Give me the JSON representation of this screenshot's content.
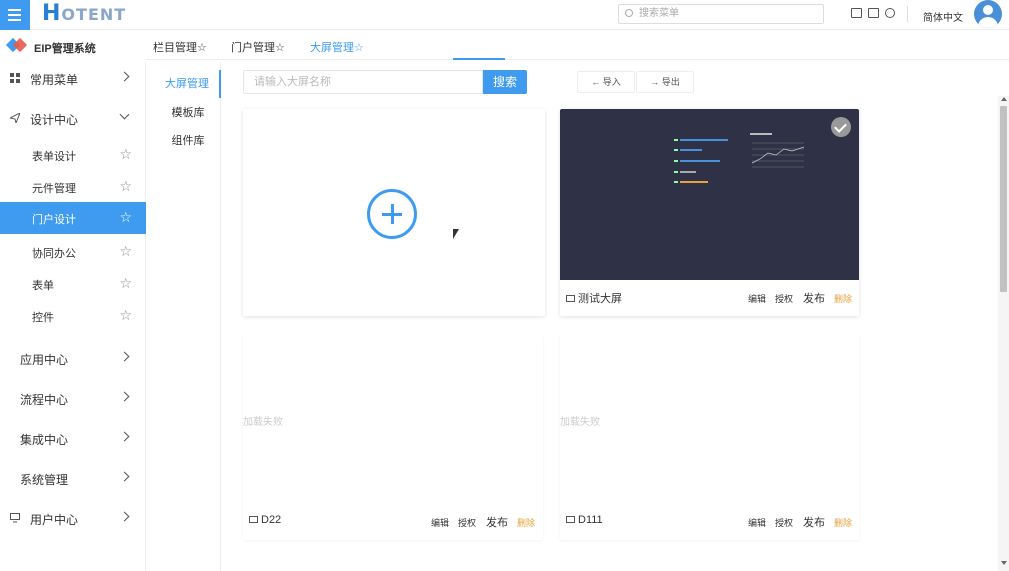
{
  "header": {
    "logo_h": "H",
    "logo_rest": "OTENT",
    "search_placeholder": "搜索菜单",
    "language": "简体中文"
  },
  "system": {
    "name": "EIP管理系统"
  },
  "tabs": [
    {
      "label": "栏目管理☆",
      "active": false
    },
    {
      "label": "门户管理☆",
      "active": false
    },
    {
      "label": "大屏管理☆",
      "active": true
    }
  ],
  "sidebar": {
    "common": "常用菜单",
    "design_center": "设计中心",
    "sub_items": [
      {
        "label": "表单设计",
        "active": false
      },
      {
        "label": "元件管理",
        "active": false
      },
      {
        "label": "门户设计",
        "active": true
      },
      {
        "label": "协同办公",
        "active": false
      },
      {
        "label": "表单",
        "active": false
      },
      {
        "label": "控件",
        "active": false
      }
    ],
    "groups": [
      "应用中心",
      "流程中心",
      "集成中心",
      "系统管理",
      "用户中心"
    ]
  },
  "subnav": [
    "大屏管理",
    "模板库",
    "组件库"
  ],
  "toolbar": {
    "search_placeholder": "请输入大屏名称",
    "search_btn": "搜索",
    "import": "← 导入",
    "export": "→ 导出"
  },
  "cards": [
    {
      "name": "测试大屏",
      "status": ""
    },
    {
      "name": "D22",
      "status": "加载失败"
    },
    {
      "name": "D111",
      "status": "加载失败"
    }
  ],
  "card_actions": {
    "edit": "编辑",
    "auth": "授权",
    "publish": "发布",
    "delete": "删除"
  },
  "colors": {
    "accent": "#3e9bef",
    "danger": "#e6a23c",
    "thumb_bg": "#2f3246"
  }
}
